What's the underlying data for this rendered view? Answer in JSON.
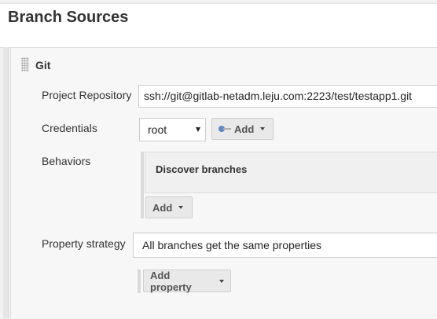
{
  "section": {
    "title": "Branch Sources"
  },
  "git": {
    "title": "Git",
    "project_repository": {
      "label": "Project Repository",
      "value": "ssh://git@gitlab-netadm.leju.com:2223/test/testapp1.git"
    },
    "credentials": {
      "label": "Credentials",
      "selected": "root",
      "add_label": "Add"
    },
    "behaviors": {
      "label": "Behaviors",
      "items": [
        {
          "title": "Discover branches"
        }
      ],
      "add_label": "Add"
    },
    "property_strategy": {
      "label": "Property strategy",
      "value": "All branches get the same properties",
      "add_label": "Add property"
    }
  },
  "colors": {
    "panel_background": "#f2f2f2",
    "button_background": "#e9e9e9",
    "key_icon": "#5b8bc9"
  }
}
